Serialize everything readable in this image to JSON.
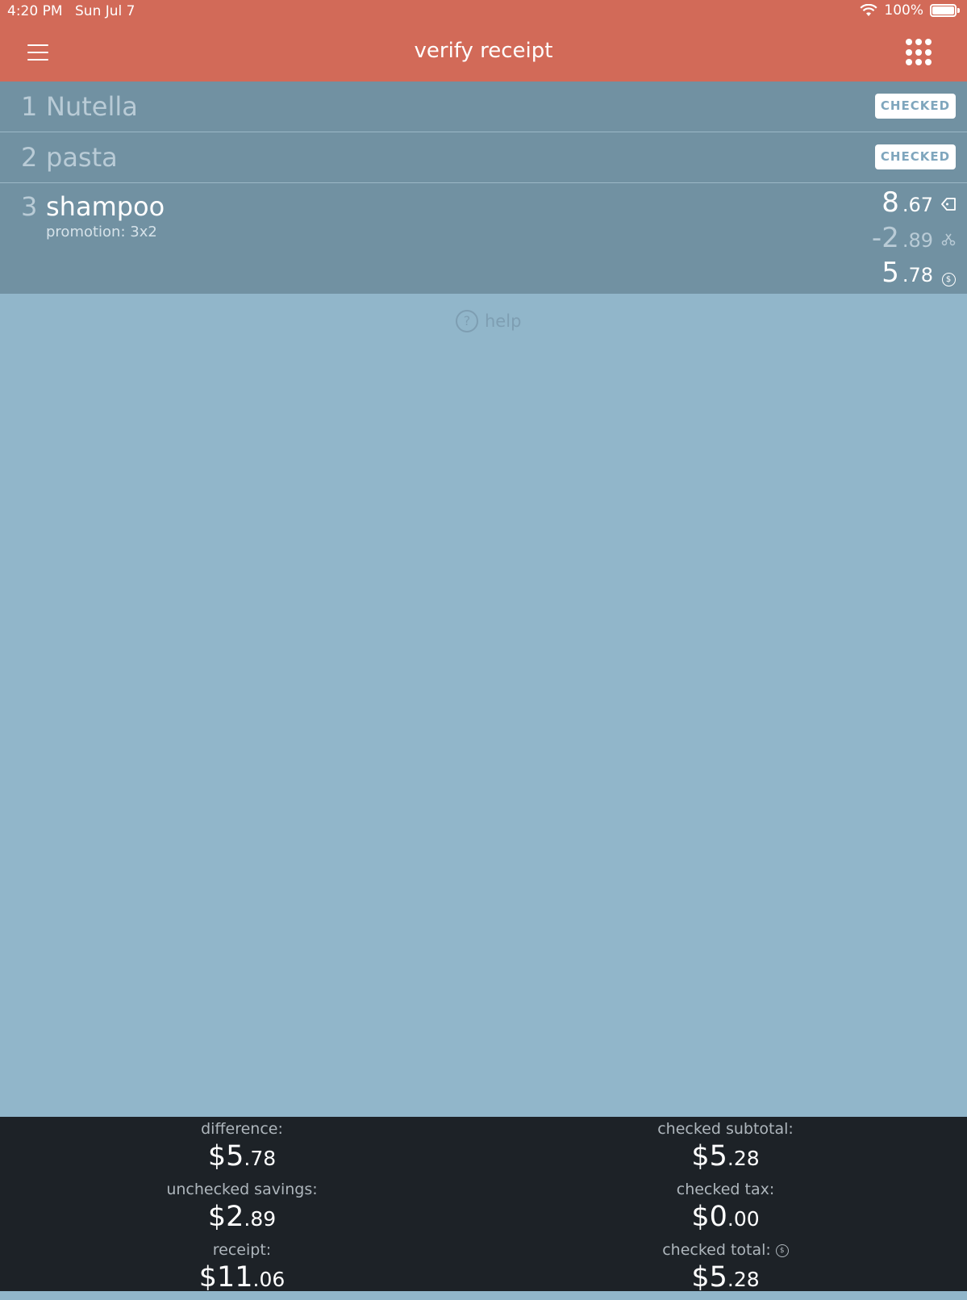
{
  "status": {
    "time": "4:20 PM",
    "date": "Sun Jul 7",
    "battery": "100%"
  },
  "header": {
    "title": "verify receipt"
  },
  "items": [
    {
      "num": "1",
      "name": "Nutella",
      "badge": "CHECKED"
    },
    {
      "num": "2",
      "name": "pasta",
      "badge": "CHECKED"
    },
    {
      "num": "3",
      "name": "shampoo",
      "promo": "promotion: 3x2",
      "price": {
        "int": "8",
        "dec": ".67"
      },
      "discount": {
        "int": "-2",
        "dec": ".89"
      },
      "total": {
        "int": "5",
        "dec": ".78"
      }
    }
  ],
  "help": {
    "label": "help"
  },
  "footer": {
    "difference": {
      "label": "difference:",
      "int": "$5",
      "dec": ".78"
    },
    "unchecked_savings": {
      "label": "unchecked savings:",
      "int": "$2",
      "dec": ".89"
    },
    "receipt": {
      "label": "receipt:",
      "int": "$11",
      "dec": ".06"
    },
    "checked_subtotal": {
      "label": "checked subtotal:",
      "int": "$5",
      "dec": ".28"
    },
    "checked_tax": {
      "label": "checked tax:",
      "int": "$0",
      "dec": ".00"
    },
    "checked_total": {
      "label": "checked total:",
      "int": "$5",
      "dec": ".28"
    }
  },
  "colors": {
    "accent": "#d26a58",
    "row": "#7191a2",
    "background": "#91b6ca",
    "footer": "#1d2227"
  }
}
